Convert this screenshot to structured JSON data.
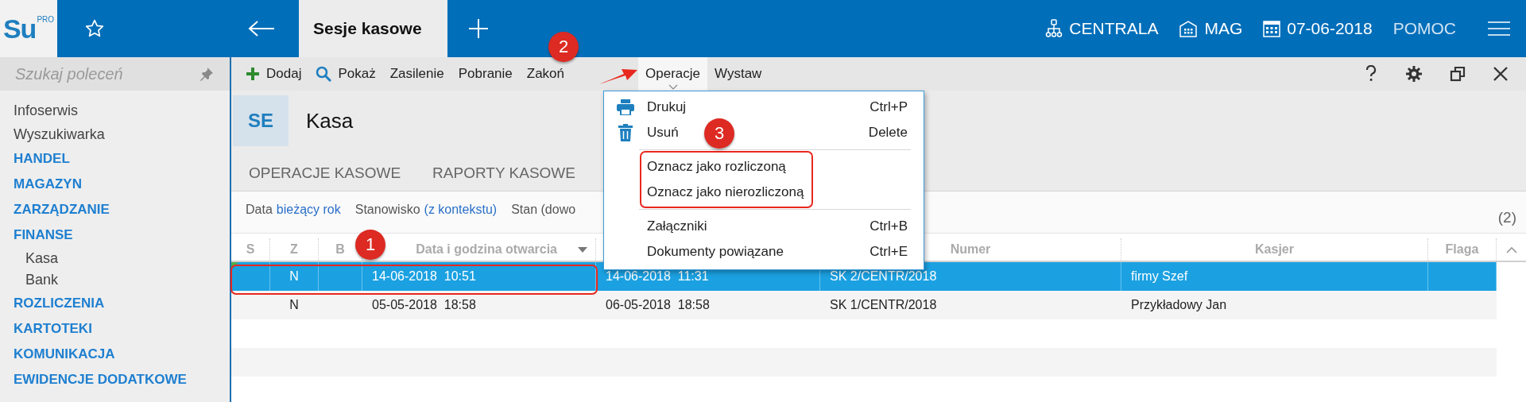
{
  "logo": {
    "text": "Su",
    "badge": "PRO"
  },
  "open_tab": {
    "label": "Sesje kasowe"
  },
  "header_items": [
    {
      "kind": "network",
      "label": "CENTRALA"
    },
    {
      "kind": "building",
      "label": "MAG"
    },
    {
      "kind": "calendar",
      "label": "07-06-2018"
    },
    {
      "kind": "plain",
      "label": "POMOC"
    }
  ],
  "sidebar": {
    "search_placeholder": "Szukaj poleceń",
    "items": [
      {
        "kind": "link",
        "label": "Infoserwis"
      },
      {
        "kind": "link",
        "label": "Wyszukiwarka"
      },
      {
        "kind": "section",
        "label": "HANDEL"
      },
      {
        "kind": "section",
        "label": "MAGAZYN"
      },
      {
        "kind": "section",
        "label": "ZARZĄDZANIE"
      },
      {
        "kind": "section",
        "label": "FINANSE",
        "children": [
          {
            "label": "Kasa"
          },
          {
            "label": "Bank"
          }
        ]
      },
      {
        "kind": "section",
        "label": "ROZLICZENIA"
      },
      {
        "kind": "section",
        "label": "KARTOTEKI"
      },
      {
        "kind": "section",
        "label": "KOMUNIKACJA"
      },
      {
        "kind": "section",
        "label": "EWIDENCJE DODATKOWE"
      }
    ]
  },
  "toolbar": [
    {
      "kind": "add",
      "label": "Dodaj",
      "active": false
    },
    {
      "kind": "search",
      "label": "Pokaż",
      "active": false
    },
    {
      "kind": "text",
      "label": "Zasilenie",
      "active": false
    },
    {
      "kind": "text",
      "label": "Pobranie",
      "active": false
    },
    {
      "kind": "text",
      "label": "Zakoń",
      "active": false
    },
    {
      "kind": "text",
      "label": "Operacje",
      "active": true
    },
    {
      "kind": "text",
      "label": "Wystaw",
      "active": false
    }
  ],
  "module": {
    "badge": "SE",
    "title": "Kasa"
  },
  "tabs": [
    {
      "label": "OPERACJE KASOWE",
      "selected": false
    },
    {
      "label": "RAPORTY KASOWE",
      "selected": false
    }
  ],
  "filters": [
    {
      "label": "Data",
      "value": "bieżący rok"
    },
    {
      "label": "Stanowisko",
      "value": "(z kontekstu)"
    },
    {
      "label": "Stan (dowo"
    }
  ],
  "count": "(2)",
  "table": {
    "columns": [
      {
        "label": "S"
      },
      {
        "label": "Z"
      },
      {
        "label": "B"
      },
      {
        "label": "Data i godzina otwarcia",
        "sorted": true
      },
      {
        "label": "Numer"
      },
      {
        "label": "Kasjer"
      },
      {
        "label": "Flaga"
      }
    ],
    "rows": [
      {
        "selected": true,
        "flagged": true,
        "z": "N",
        "opened": "14-06-2018  10:51",
        "closed": "14-06-2018  11:31",
        "number": "SK 2/CENTR/2018",
        "cashier": "firmy Szef"
      },
      {
        "selected": false,
        "flagged": false,
        "z": "N",
        "opened": "05-05-2018  18:58",
        "closed": "06-05-2018  18:58",
        "number": "SK 1/CENTR/2018",
        "cashier": "Przykładowy Jan"
      }
    ]
  },
  "menu": [
    {
      "kind": "print",
      "label": "Drukuj",
      "shortcut": "Ctrl+P"
    },
    {
      "kind": "delete",
      "label": "Usuń",
      "shortcut": "Delete"
    },
    {
      "kind": "separator"
    },
    {
      "kind": "plain",
      "label": "Oznacz jako rozliczoną"
    },
    {
      "kind": "plain",
      "label": "Oznacz jako nierozliczoną"
    },
    {
      "kind": "separator"
    },
    {
      "kind": "plain",
      "label": "Załączniki",
      "shortcut": "Ctrl+B"
    },
    {
      "kind": "plain",
      "label": "Dokumenty powiązane",
      "shortcut": "Ctrl+E"
    }
  ],
  "callouts": [
    {
      "label": "1"
    },
    {
      "label": "2"
    },
    {
      "label": "3"
    }
  ]
}
